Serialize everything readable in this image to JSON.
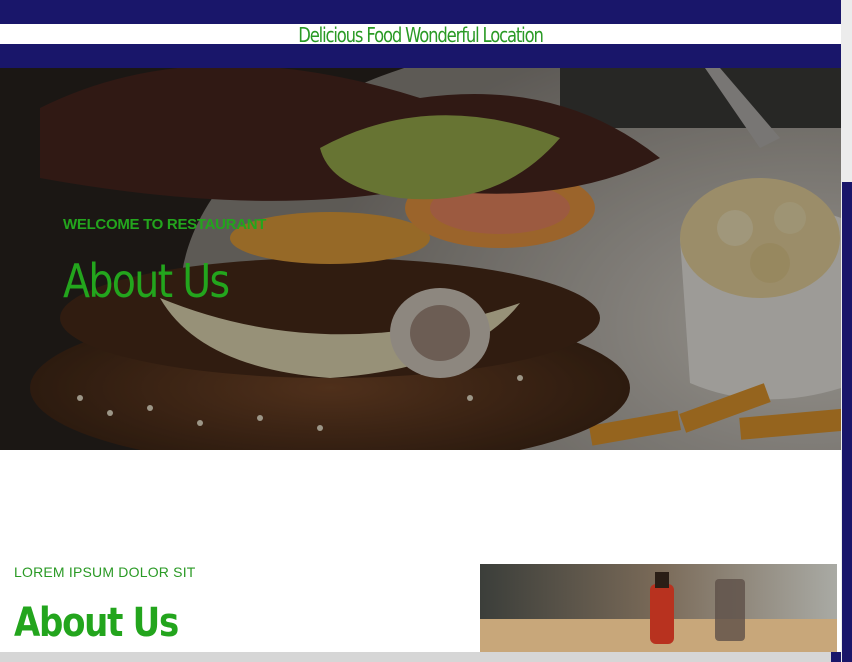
{
  "header": {
    "tagline": "Delicious Food Wonderful Location"
  },
  "hero": {
    "kicker": "WELCOME TO RESTAURANT",
    "title": "About Us",
    "image_icon": "burger-photo"
  },
  "about": {
    "kicker": "LOREM IPSUM DOLOR SIT",
    "title": "About Us",
    "image_icon": "restaurant-table-photo"
  },
  "colors": {
    "brand_navy": "#19166a",
    "accent_green": "#23a51d"
  }
}
